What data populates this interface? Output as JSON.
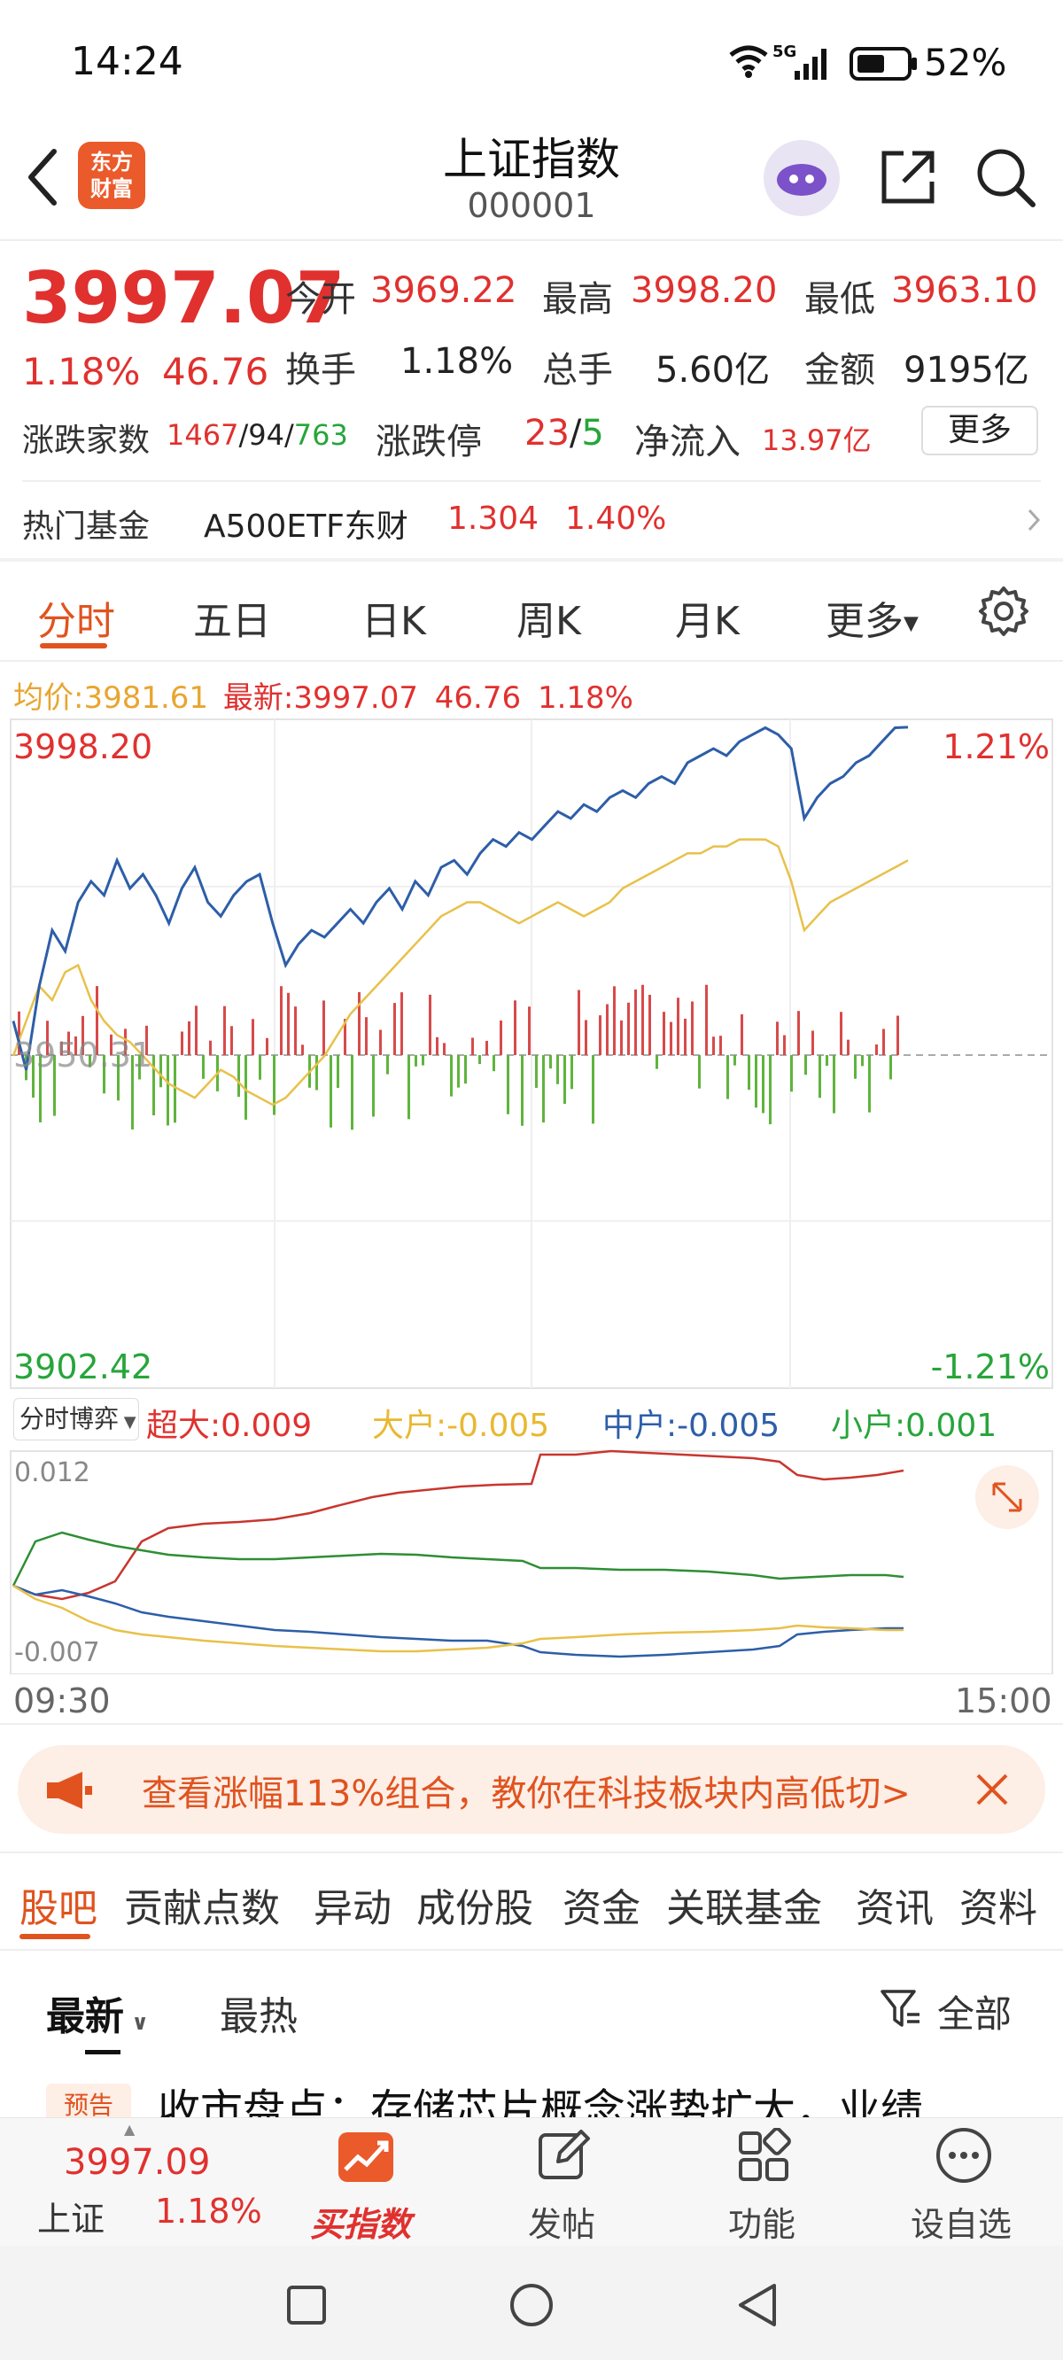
{
  "status_bar": {
    "time": "14:24",
    "network": "5G",
    "battery": "52%"
  },
  "header": {
    "logo_text": "东方财富",
    "title": "上证指数",
    "code": "000001"
  },
  "quote": {
    "price": "3997.07",
    "change_pct": "1.18%",
    "change": "46.76",
    "open_label": "今开",
    "open": "3969.22",
    "high_label": "最高",
    "high": "3998.20",
    "low_label": "最低",
    "low": "3963.10",
    "turnover_label": "换手",
    "turnover": "1.18%",
    "volume_label": "总手",
    "volume": "5.60亿",
    "amount_label": "金额",
    "amount": "9195亿",
    "breadth_label": "涨跌家数",
    "breadth_up": "1467",
    "breadth_flat": "94",
    "breadth_down": "763",
    "limit_label": "涨跌停",
    "limit_up": "23",
    "limit_down": "5",
    "netflow_label": "净流入",
    "netflow": "13.97亿",
    "more_button": "更多"
  },
  "hot_fund": {
    "label": "热门基金",
    "name": "A500ETF东财",
    "price": "1.304",
    "pct": "1.40%"
  },
  "chart_tabs": {
    "items": [
      "分时",
      "五日",
      "日K",
      "周K",
      "月K",
      "更多"
    ],
    "active": "分时"
  },
  "chart_info": {
    "avg_label": "均价:",
    "avg": "3981.61",
    "latest_label": "最新:",
    "latest": "3997.07",
    "change": "46.76",
    "pct": "1.18%"
  },
  "chart_data": {
    "type": "line",
    "ylim": [
      3902.42,
      3998.2
    ],
    "y_top_label": "3998.20",
    "y_bottom_label": "3902.42",
    "pct_top_label": "1.21%",
    "pct_bottom_label": "-1.21%",
    "prev_close_label": "3950.31",
    "series": [
      {
        "name": "最新",
        "color": "#2d5ea8",
        "values": [
          3955,
          3948,
          3960,
          3968,
          3965,
          3972,
          3975,
          3973,
          3978,
          3974,
          3976,
          3973,
          3969,
          3974,
          3977,
          3972,
          3970,
          3973,
          3975,
          3976,
          3969,
          3963,
          3966,
          3968,
          3967,
          3969,
          3971,
          3969,
          3972,
          3974,
          3971,
          3975,
          3973,
          3977,
          3978,
          3976,
          3979,
          3981,
          3980,
          3982,
          3981,
          3983,
          3985,
          3984,
          3986,
          3985,
          3987,
          3988,
          3987,
          3989,
          3990,
          3989,
          3992,
          3993,
          3994,
          3993,
          3995,
          3996,
          3997,
          3996,
          3994,
          3984,
          3987,
          3989,
          3990,
          3992,
          3993,
          3995,
          3997,
          3997.07
        ]
      },
      {
        "name": "均价",
        "color": "#e8c14a",
        "values": [
          3950,
          3955,
          3960,
          3958,
          3962,
          3963,
          3958,
          3955,
          3953,
          3952,
          3950,
          3948,
          3946,
          3945,
          3944,
          3946,
          3948,
          3947,
          3945,
          3944,
          3943,
          3944,
          3946,
          3948,
          3950,
          3953,
          3956,
          3958,
          3960,
          3962,
          3964,
          3966,
          3968,
          3970,
          3971,
          3972,
          3972,
          3971,
          3970,
          3969,
          3970,
          3971,
          3972,
          3971,
          3970,
          3971,
          3972,
          3974,
          3975,
          3976,
          3977,
          3978,
          3979,
          3979,
          3980,
          3980,
          3981,
          3981,
          3981,
          3980,
          3975,
          3968,
          3970,
          3972,
          3973,
          3974,
          3975,
          3976,
          3977,
          3978
        ]
      }
    ],
    "x_start": "09:30",
    "x_end": "15:00"
  },
  "flow": {
    "dropdown": "分时博弈",
    "super_label": "超大:",
    "super": "0.009",
    "large_label": "大户:",
    "large": "-0.005",
    "medium_label": "中户:",
    "medium": "-0.005",
    "small_label": "小户:",
    "small": "0.001",
    "y_top": "0.012",
    "y_bottom": "-0.007",
    "time_start": "09:30",
    "time_end": "15:00"
  },
  "banner": {
    "text": "查看涨幅113%组合，教你在科技板块内高低切>"
  },
  "section_tabs": {
    "items": [
      "股吧",
      "贡献点数",
      "异动",
      "成份股",
      "资金",
      "关联基金",
      "资讯",
      "资料"
    ],
    "active": "股吧"
  },
  "feed": {
    "sort_latest": "最新",
    "sort_hot": "最热",
    "filter": "全部",
    "badge": "预告",
    "headline": "收市盘点：存储芯片概念涨势扩大，业绩"
  },
  "bottom_nav": {
    "index_price": "3997.09",
    "index_name": "上证",
    "index_pct": "1.18%",
    "buy": "买指数",
    "post": "发帖",
    "func": "功能",
    "watch": "设自选"
  },
  "colors": {
    "up": "#e0312f",
    "down": "#27a53a",
    "accent": "#e0531f",
    "price_line": "#2d5ea8",
    "avg_line": "#e8c14a"
  }
}
